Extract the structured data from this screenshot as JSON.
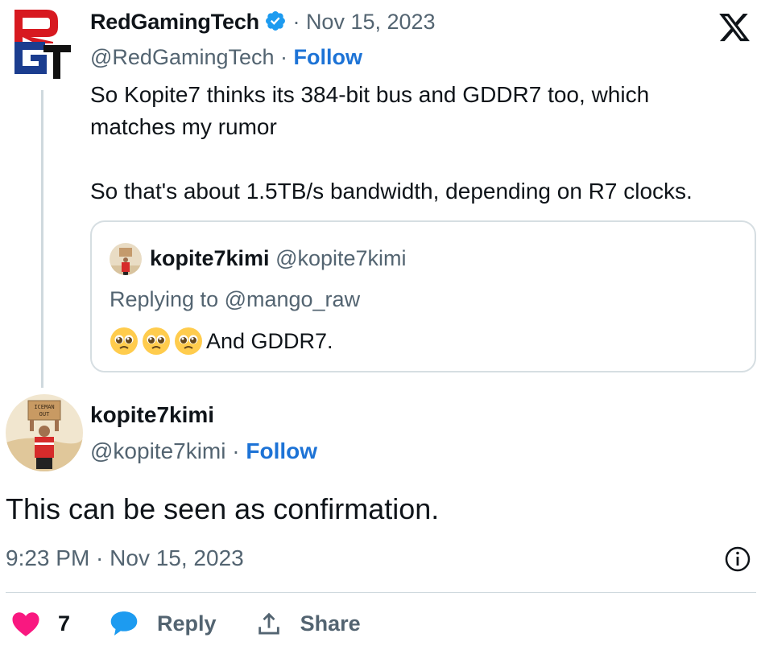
{
  "quoted_tweet": {
    "display_name": "RedGamingTech",
    "date": "Nov 15, 2023",
    "handle": "@RedGamingTech",
    "follow_label": "Follow",
    "text_line1": "So Kopite7 thinks its 384-bit bus and GDDR7 too, which",
    "text_line2": "matches my rumor",
    "text_line3": "So that's about 1.5TB/s bandwidth, depending on R7 clocks."
  },
  "inner_quote": {
    "display_name": "kopite7kimi",
    "handle": "@kopite7kimi",
    "replying_to": "Replying to @mango_raw",
    "text": "And GDDR7."
  },
  "main_tweet": {
    "display_name": "kopite7kimi",
    "handle": "@kopite7kimi",
    "follow_label": "Follow",
    "text": "This can be seen as confirmation.",
    "timestamp": "9:23 PM · Nov 15, 2023",
    "avatar_sign_text": "ICEMAN OUT"
  },
  "actions": {
    "likes": "7",
    "reply_label": "Reply",
    "share_label": "Share"
  },
  "colors": {
    "accent": "#1d9bf0",
    "follow": "#1d73d6",
    "like": "#f91880",
    "muted": "#536471",
    "logo_red": "#d71920",
    "logo_blue": "#1b3d8f"
  },
  "icons": [
    "rgt-logo-icon",
    "verified-badge-icon",
    "x-logo-icon",
    "pleading-face-emoji-icon",
    "info-icon",
    "heart-icon",
    "reply-bubble-icon",
    "share-icon"
  ]
}
